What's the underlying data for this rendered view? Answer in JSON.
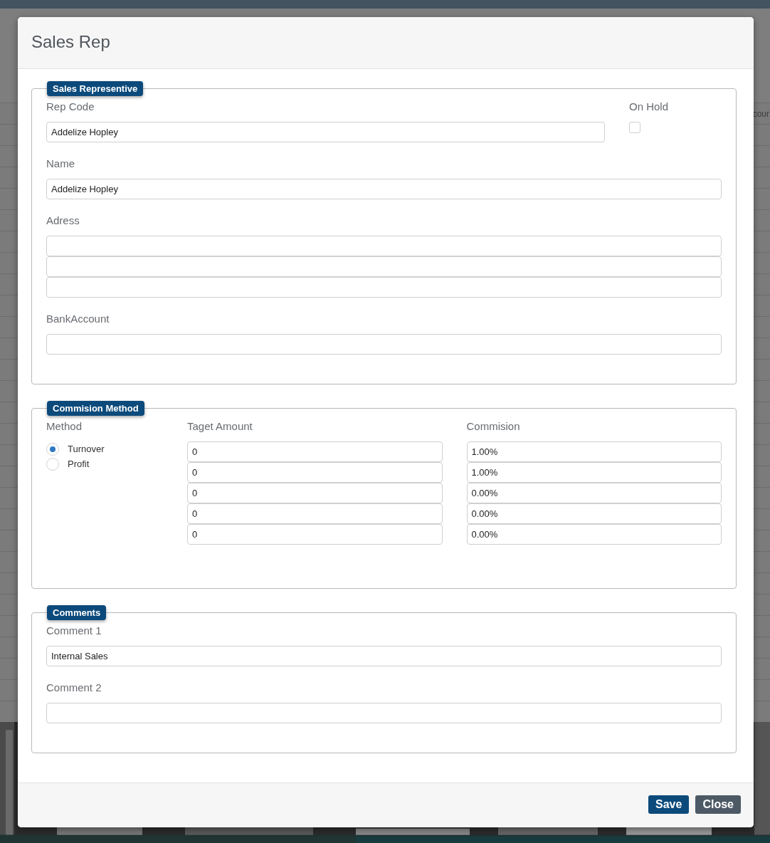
{
  "background": {
    "column_fragment": "cour"
  },
  "dialog": {
    "title": "Sales Rep"
  },
  "sales_representative": {
    "legend": "Sales Representive",
    "rep_code": {
      "label": "Rep Code",
      "value": "Addelize Hopley"
    },
    "on_hold": {
      "label": "On Hold",
      "checked": false
    },
    "name": {
      "label": "Name",
      "value": "Addelize Hopley"
    },
    "address": {
      "label": "Adress",
      "fields": [
        {
          "kind": "input"
        },
        {
          "kind": "input"
        },
        {
          "kind": "input"
        }
      ]
    },
    "bank_account": {
      "label": "BankAccount"
    }
  },
  "commission_method": {
    "legend": "Commision Method",
    "method": {
      "label": "Method",
      "options": [
        {
          "label": "Turnover",
          "selected": true
        },
        {
          "label": "Profit",
          "selected": false
        }
      ]
    },
    "columns": [
      {
        "label": "Taget Amount"
      },
      {
        "label": "Commision"
      }
    ],
    "rows": [
      {
        "target": "0",
        "commission": "1.00%"
      },
      {
        "target": "0",
        "commission": "1.00%"
      },
      {
        "target": "0",
        "commission": "0.00%"
      },
      {
        "target": "0",
        "commission": "0.00%"
      },
      {
        "target": "0",
        "commission": "0.00%"
      }
    ]
  },
  "comments": {
    "legend": "Comments",
    "comment_1": {
      "label": "Comment 1",
      "value": "Internal Sales"
    },
    "comment_2": {
      "label": "Comment 2"
    }
  },
  "buttons": [
    {
      "label": "Save",
      "kind": "primary"
    },
    {
      "label": "Close",
      "kind": "secondary"
    }
  ]
}
